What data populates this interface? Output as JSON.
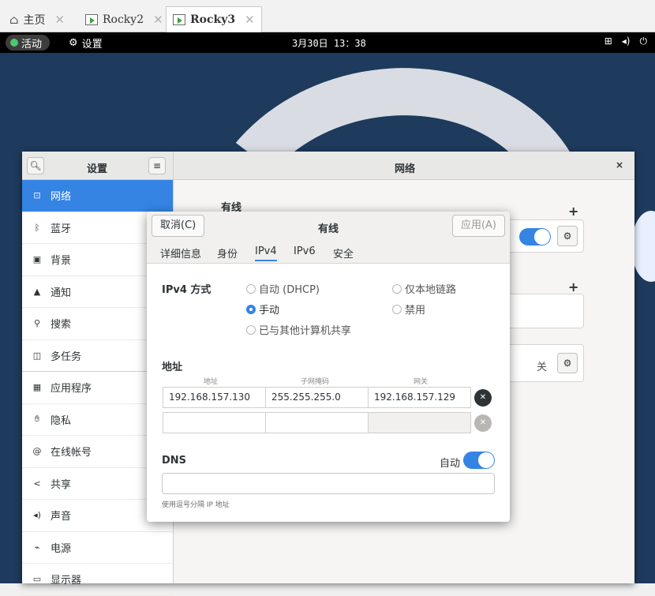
{
  "vm_tabs": [
    {
      "label": "主页",
      "icon": "home-icon",
      "active": false
    },
    {
      "label": "Rocky2",
      "icon": "vm-icon",
      "active": false
    },
    {
      "label": "Rocky3",
      "icon": "vm-icon",
      "active": true
    }
  ],
  "topbar": {
    "activities": "活动",
    "app": "设置",
    "clock": "3月30日 13：38"
  },
  "settings": {
    "sidebar_title": "设置",
    "page_title": "网络",
    "close": "×",
    "sidebar_items": [
      {
        "label": "网络",
        "icon": "network-icon"
      },
      {
        "label": "蓝牙",
        "icon": "bluetooth-icon"
      },
      {
        "label": "背景",
        "icon": "background-icon"
      },
      {
        "label": "通知",
        "icon": "bell-icon"
      },
      {
        "label": "搜索",
        "icon": "search-icon"
      },
      {
        "label": "多任务",
        "icon": "multitask-icon"
      },
      {
        "label": "应用程序",
        "icon": "apps-grid-icon"
      },
      {
        "label": "隐私",
        "icon": "hand-icon"
      },
      {
        "label": "在线帐号",
        "icon": "at-icon"
      },
      {
        "label": "共享",
        "icon": "share-icon"
      },
      {
        "label": "声音",
        "icon": "speaker-icon"
      },
      {
        "label": "电源",
        "icon": "power-icon"
      },
      {
        "label": "显示器",
        "icon": "display-icon"
      }
    ],
    "wired_heading": "有线",
    "off_label": "关"
  },
  "dialog": {
    "cancel": "取消(C)",
    "title": "有线",
    "apply": "应用(A)",
    "tabs": [
      "详细信息",
      "身份",
      "IPv4",
      "IPv6",
      "安全"
    ],
    "active_tab": "IPv4",
    "ipv4_method_label": "IPv4 方式",
    "methods": {
      "auto": "自动 (DHCP)",
      "link_local": "仅本地链路",
      "manual": "手动",
      "disabled": "禁用",
      "shared": "已与其他计算机共享"
    },
    "selected_method": "手动",
    "address_label": "地址",
    "columns": [
      "地址",
      "子网掩码",
      "网关"
    ],
    "rows": [
      {
        "address": "192.168.157.130",
        "netmask": "255.255.255.0",
        "gateway": "192.168.157.129"
      },
      {
        "address": "",
        "netmask": "",
        "gateway": ""
      }
    ],
    "dns_label": "DNS",
    "dns_auto_label": "自动",
    "dns_auto": true,
    "dns_value": "",
    "dns_hint": "使用逗号分隔 IP 地址"
  },
  "colors": {
    "accent": "#3584e4",
    "topbar": "#000000",
    "desktop": "#1e3a5c"
  }
}
